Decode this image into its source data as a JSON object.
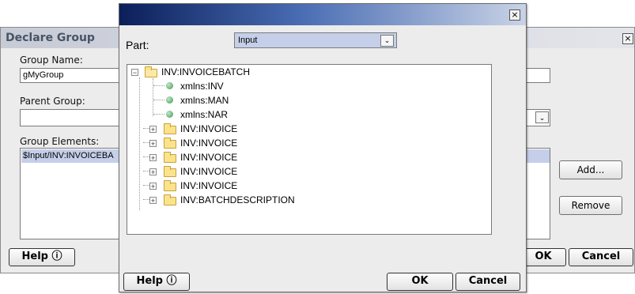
{
  "back_dialog": {
    "title": "Declare Group",
    "close_label": "×",
    "group_name_label": "Group Name:",
    "group_name_value": "gMyGroup",
    "parent_group_label": "Parent Group:",
    "parent_group_value": "",
    "group_elements_label": "Group Elements:",
    "group_elements_items": [
      "$Input/INV:INVOICEBA"
    ],
    "add_button": "Add...",
    "remove_button": "Remove",
    "help_button": "Help ⓘ",
    "ok_button": "OK",
    "cancel_button": "Cancel"
  },
  "front_dialog": {
    "close_label": "×",
    "part_label": "Part:",
    "part_value": "Input",
    "dropdown_icon": "chevron-down-icon",
    "tree": [
      {
        "label": "INV:INVOICEBATCH",
        "type": "folder",
        "expanded": true
      },
      {
        "label": "xmlns:INV",
        "type": "attribute"
      },
      {
        "label": "xmlns:MAN",
        "type": "attribute"
      },
      {
        "label": "xmlns:NAR",
        "type": "attribute"
      },
      {
        "label": "INV:INVOICE",
        "type": "folder",
        "expanded": false
      },
      {
        "label": "INV:INVOICE",
        "type": "folder",
        "expanded": false
      },
      {
        "label": "INV:INVOICE",
        "type": "folder",
        "expanded": false
      },
      {
        "label": "INV:INVOICE",
        "type": "folder",
        "expanded": false
      },
      {
        "label": "INV:INVOICE",
        "type": "folder",
        "expanded": false
      },
      {
        "label": "INV:BATCHDESCRIPTION",
        "type": "folder",
        "expanded": false
      }
    ],
    "help_button": "Help ⓘ",
    "ok_button": "OK",
    "cancel_button": "Cancel"
  },
  "colors": {
    "titlebar_dark": "#0b1f5a",
    "titlebar_light": "#c9d3e6",
    "selection_blue": "#c5cfe9",
    "folder_yellow": "#fbe38c",
    "attribute_green": "#3e9a54"
  }
}
